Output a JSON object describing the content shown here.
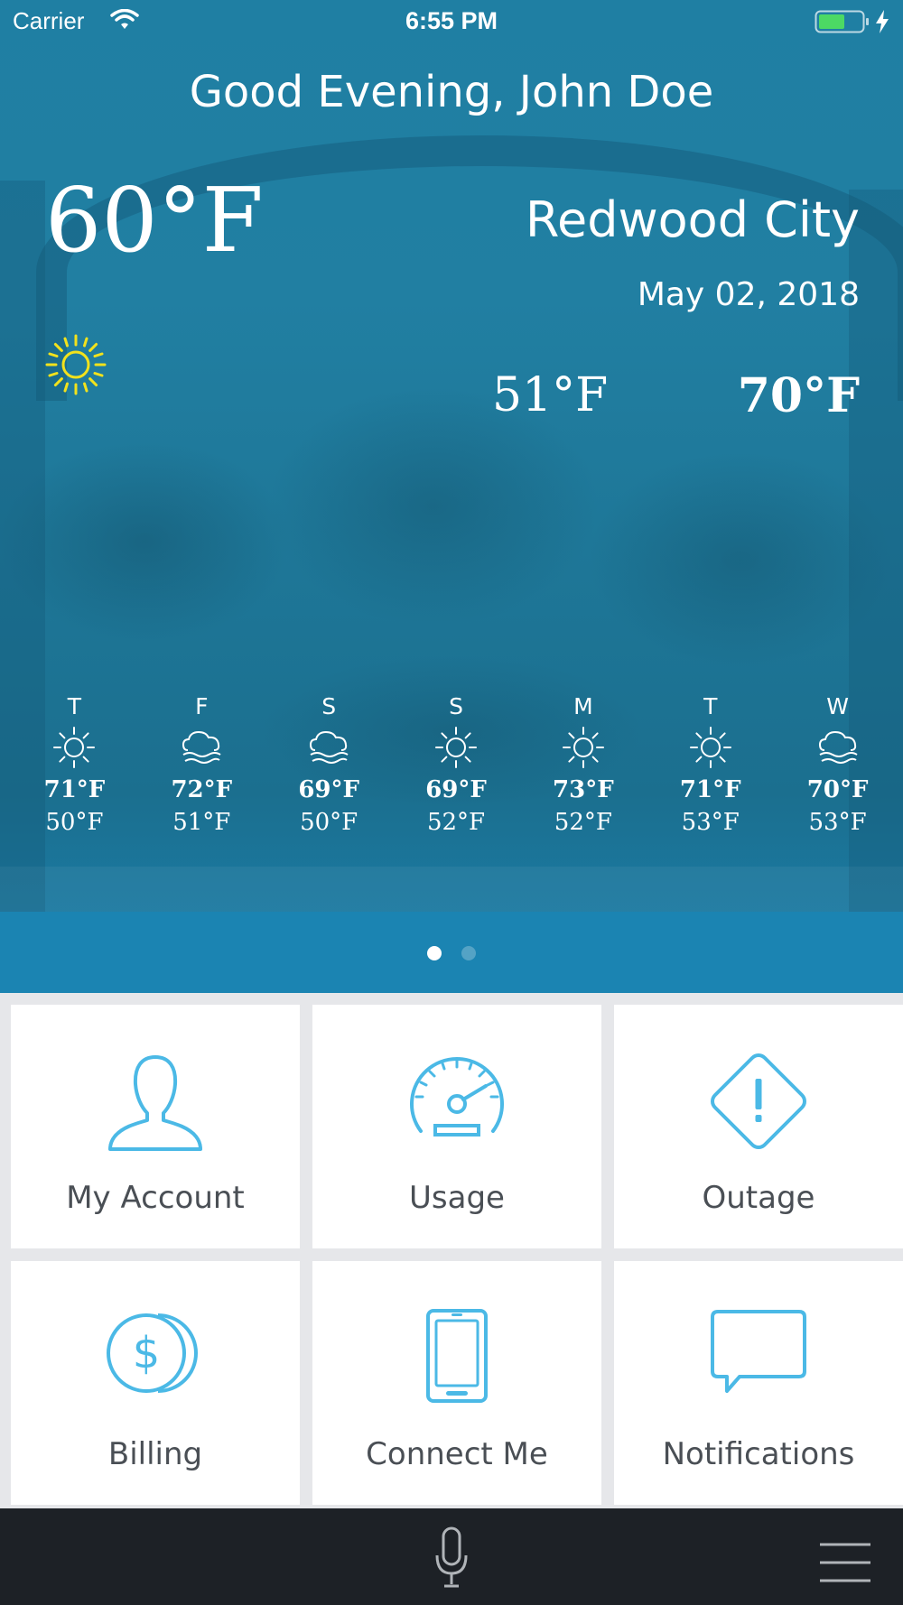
{
  "status_bar": {
    "carrier": "Carrier",
    "time": "6:55 PM",
    "wifi_icon": "wifi-icon",
    "battery_icon": "battery-icon",
    "charging_icon": "charging-bolt-icon"
  },
  "weather": {
    "greeting": "Good Evening, John Doe",
    "current_temp": "60°F",
    "city": "Redwood City",
    "date": "May 02, 2018",
    "condition_icon": "sun-icon",
    "low": "51°F",
    "high": "70°F",
    "accent_color": "#f2e21c",
    "forecast": [
      {
        "day": "T",
        "icon": "sun-icon",
        "high": "71°F",
        "low": "50°F"
      },
      {
        "day": "F",
        "icon": "cloud-fog-icon",
        "high": "72°F",
        "low": "51°F"
      },
      {
        "day": "S",
        "icon": "cloud-fog-icon",
        "high": "69°F",
        "low": "50°F"
      },
      {
        "day": "S",
        "icon": "sun-icon",
        "high": "69°F",
        "low": "52°F"
      },
      {
        "day": "M",
        "icon": "sun-icon",
        "high": "73°F",
        "low": "52°F"
      },
      {
        "day": "T",
        "icon": "sun-icon",
        "high": "71°F",
        "low": "53°F"
      },
      {
        "day": "W",
        "icon": "cloud-fog-icon",
        "high": "70°F",
        "low": "53°F"
      }
    ],
    "pager": {
      "pages": 2,
      "current": 1
    }
  },
  "menu_tiles": [
    {
      "label": "My Account",
      "icon": "user-icon"
    },
    {
      "label": "Usage",
      "icon": "speedometer-icon"
    },
    {
      "label": "Outage",
      "icon": "warning-diamond-icon"
    },
    {
      "label": "Billing",
      "icon": "coins-dollar-icon"
    },
    {
      "label": "Connect Me",
      "icon": "phone-icon"
    },
    {
      "label": "Notifications",
      "icon": "chat-bubble-icon"
    }
  ],
  "bottom_bar": {
    "mic_icon": "microphone-icon",
    "menu_icon": "hamburger-menu-icon"
  },
  "colors": {
    "hero_blue": "#1f7fa3",
    "tile_icon_blue": "#4bb9e6",
    "tile_label": "#4a4f55",
    "bottom_bar": "#1d2126"
  }
}
